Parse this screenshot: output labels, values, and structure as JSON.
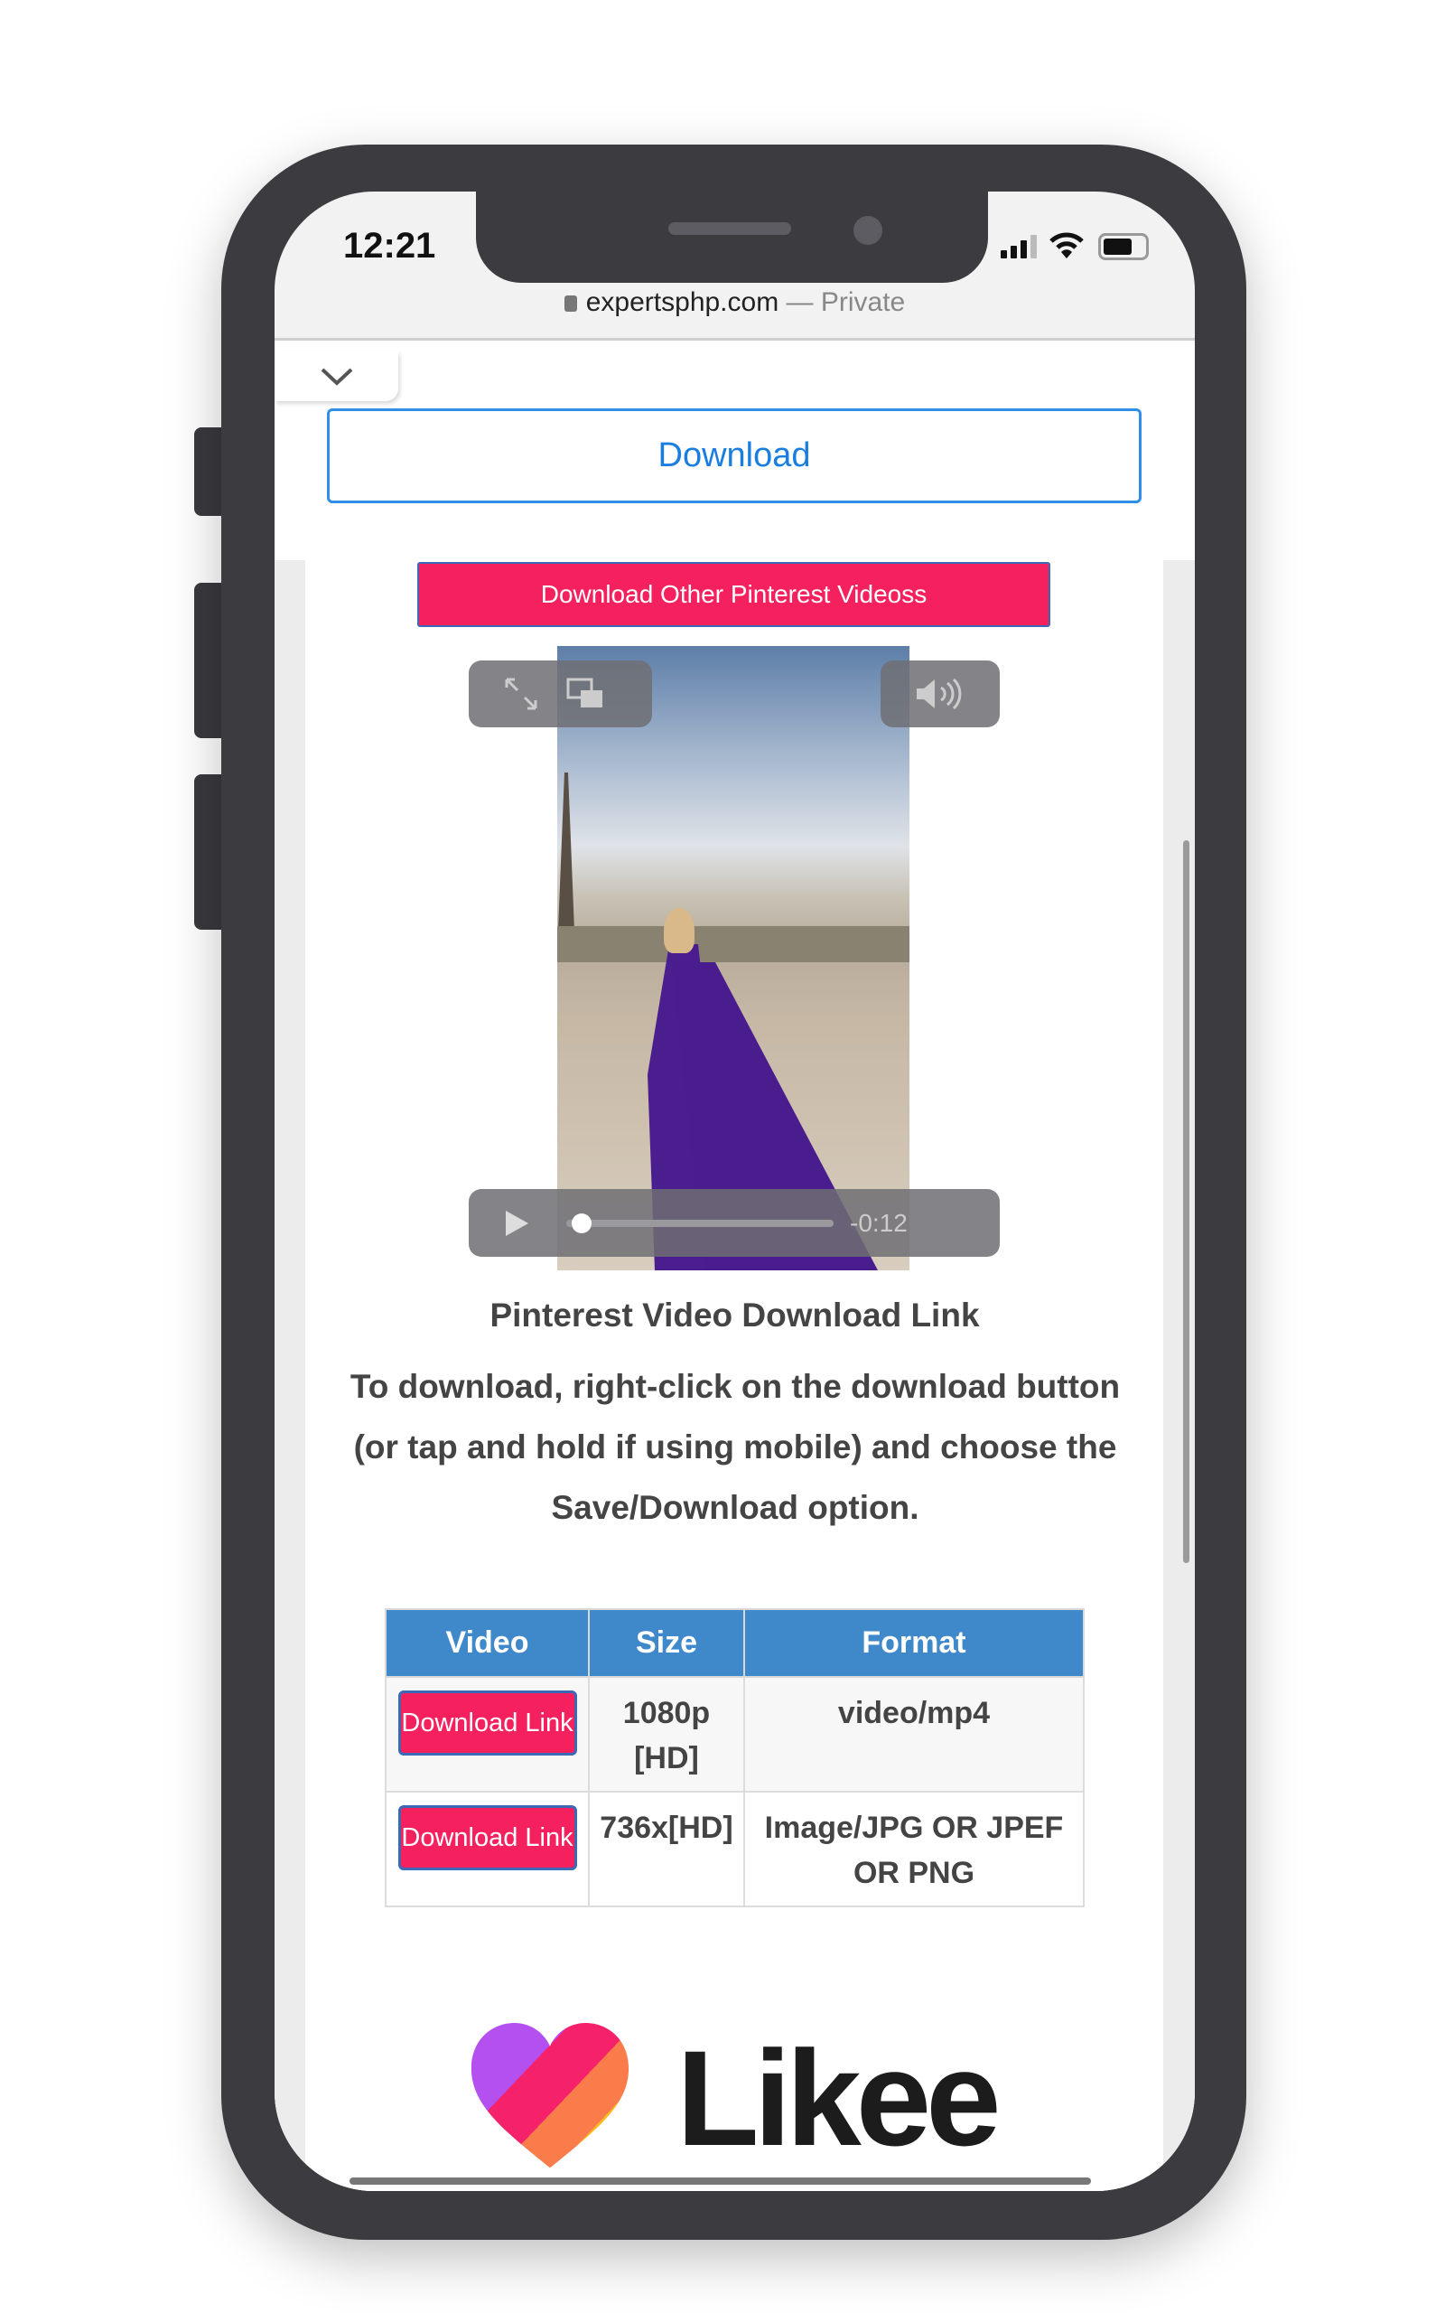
{
  "status_bar": {
    "time": "12:21",
    "icons": [
      "signal-icon",
      "wifi-icon",
      "battery-icon"
    ]
  },
  "address_bar": {
    "domain": "expertsphp.com",
    "separator": " — ",
    "mode": "Private",
    "icon": "lock-icon"
  },
  "toolbar": {
    "collapse_icon": "chevron-down-icon",
    "download_label": "Download"
  },
  "main": {
    "other_videos_label": "Download Other Pinterest Videoss",
    "video": {
      "remaining_time": "-0:12",
      "progress": 0.02
    },
    "section_title": "Pinterest Video Download Link",
    "instructions": "To download, right-click on the download button (or tap and hold if using mobile) and choose the Save/Download option.",
    "table": {
      "headers": [
        "Video",
        "Size",
        "Format"
      ],
      "rows": [
        {
          "link": "Download Link",
          "size": "1080p [HD]",
          "format": "video/mp4"
        },
        {
          "link": "Download Link",
          "size": "736x[HD]",
          "format": "Image/JPG OR JPEF OR PNG"
        }
      ]
    },
    "logo": {
      "text": "Likee"
    }
  },
  "colors": {
    "accent_pink": "#f5215f",
    "table_header": "#3f89cb",
    "link_blue": "#1a7ee0"
  }
}
